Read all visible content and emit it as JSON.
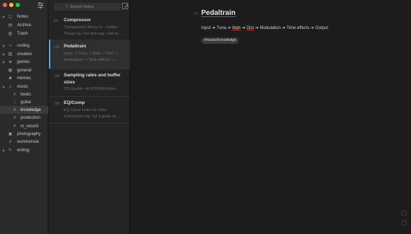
{
  "sidebar": {
    "items": [
      {
        "label": "Notes",
        "icon": "note-icon",
        "glyph": "▢"
      },
      {
        "label": "Archive",
        "icon": "archive-icon",
        "glyph": "▤"
      },
      {
        "label": "Trash",
        "icon": "trash-icon",
        "glyph": "▥"
      },
      {
        "label": "coding",
        "icon": "code-icon",
        "glyph": "‹›"
      },
      {
        "label": "creative",
        "icon": "tag-icon",
        "glyph": "▨"
      },
      {
        "label": "games",
        "icon": "gamepad-icon",
        "glyph": "◈"
      },
      {
        "label": "general",
        "icon": "tag-icon",
        "glyph": "▦"
      },
      {
        "label": "memes",
        "icon": "tag-icon",
        "glyph": "◙"
      },
      {
        "label": "music",
        "icon": "music-icon",
        "glyph": "♫"
      },
      {
        "label": "beats",
        "icon": "hash-icon",
        "glyph": "#"
      },
      {
        "label": "guitar",
        "icon": "guitar-icon",
        "glyph": "♪"
      },
      {
        "label": "knowledge",
        "icon": "hash-icon",
        "glyph": "#"
      },
      {
        "label": "production",
        "icon": "hash-icon",
        "glyph": "#"
      },
      {
        "label": "to_record",
        "icon": "hash-icon",
        "glyph": "#"
      },
      {
        "label": "photography",
        "icon": "camera-icon",
        "glyph": "▣"
      },
      {
        "label": "summerosk",
        "icon": "hash-icon",
        "glyph": "#"
      },
      {
        "label": "writing",
        "icon": "pencil-icon",
        "glyph": "✎"
      }
    ]
  },
  "notelist": {
    "search_placeholder": "Search Notes",
    "notes": [
      {
        "time": "9h",
        "title": "Compressor",
        "preview": "Compression Move #1 - Fatten Things Up The first way I like to..."
      },
      {
        "time": "16h",
        "title": "Pedaltrain",
        "preview": "Input -> Tuna -> Wah -> Dist -> Modulation -> Time effects ->..."
      },
      {
        "time": "16h",
        "title": "Sampling rates and buffer sizes",
        "preview": "CD-Quality: 44,100/16bit Adio..."
      },
      {
        "time": "16h",
        "title": "EQ/Comp",
        "preview": "EQ Carve holes for other instruments Eg. cut a guitar at..."
      }
    ]
  },
  "editor": {
    "heading_marker": "H1",
    "title": "Pedaltrain",
    "body": [
      {
        "text": "Input"
      },
      {
        "text": " ➔ "
      },
      {
        "text": "Tuna"
      },
      {
        "text": " ➔ "
      },
      {
        "text": "Wah",
        "sp": true
      },
      {
        "text": " ➔ "
      },
      {
        "text": "Dist",
        "sp": true
      },
      {
        "text": " ➔ "
      },
      {
        "text": "Modulation"
      },
      {
        "text": " ➔ "
      },
      {
        "text": "Time effects"
      },
      {
        "text": " ➔ "
      },
      {
        "text": "Output"
      }
    ],
    "tag": "#music/knowledge"
  },
  "colors": {
    "accent": "#5fa8d8",
    "spellcheck": "#c0392b",
    "selected_row": "#3a3a3a"
  }
}
